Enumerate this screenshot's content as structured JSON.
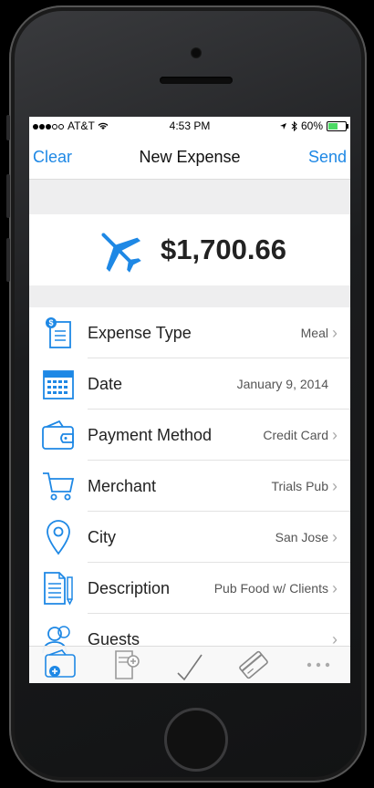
{
  "status_bar": {
    "carrier": "AT&T",
    "time": "4:53 PM",
    "battery": "60%",
    "battery_level": 0.6
  },
  "nav": {
    "left": "Clear",
    "title": "New Expense",
    "right": "Send"
  },
  "summary": {
    "icon": "airplane-icon",
    "amount": "$1,700.66"
  },
  "rows": [
    {
      "icon": "receipt-dollar-icon",
      "label": "Expense Type",
      "value": "Meal"
    },
    {
      "icon": "calendar-icon",
      "label": "Date",
      "value": "January 9, 2014"
    },
    {
      "icon": "wallet-icon",
      "label": "Payment Method",
      "value": "Credit Card"
    },
    {
      "icon": "shopping-cart-icon",
      "label": "Merchant",
      "value": "Trials Pub"
    },
    {
      "icon": "location-pin-icon",
      "label": "City",
      "value": "San Jose"
    },
    {
      "icon": "document-pencil-icon",
      "label": "Description",
      "value": "Pub Food w/ Clients"
    },
    {
      "icon": "people-icon",
      "label": "Guests",
      "value": ""
    }
  ],
  "tabbar": [
    "add-wallet-icon",
    "add-receipt-icon",
    "checkmark-icon",
    "card-icon",
    "more-icon"
  ],
  "colors": {
    "accent": "#1e88e5",
    "battery": "#4cd964"
  }
}
